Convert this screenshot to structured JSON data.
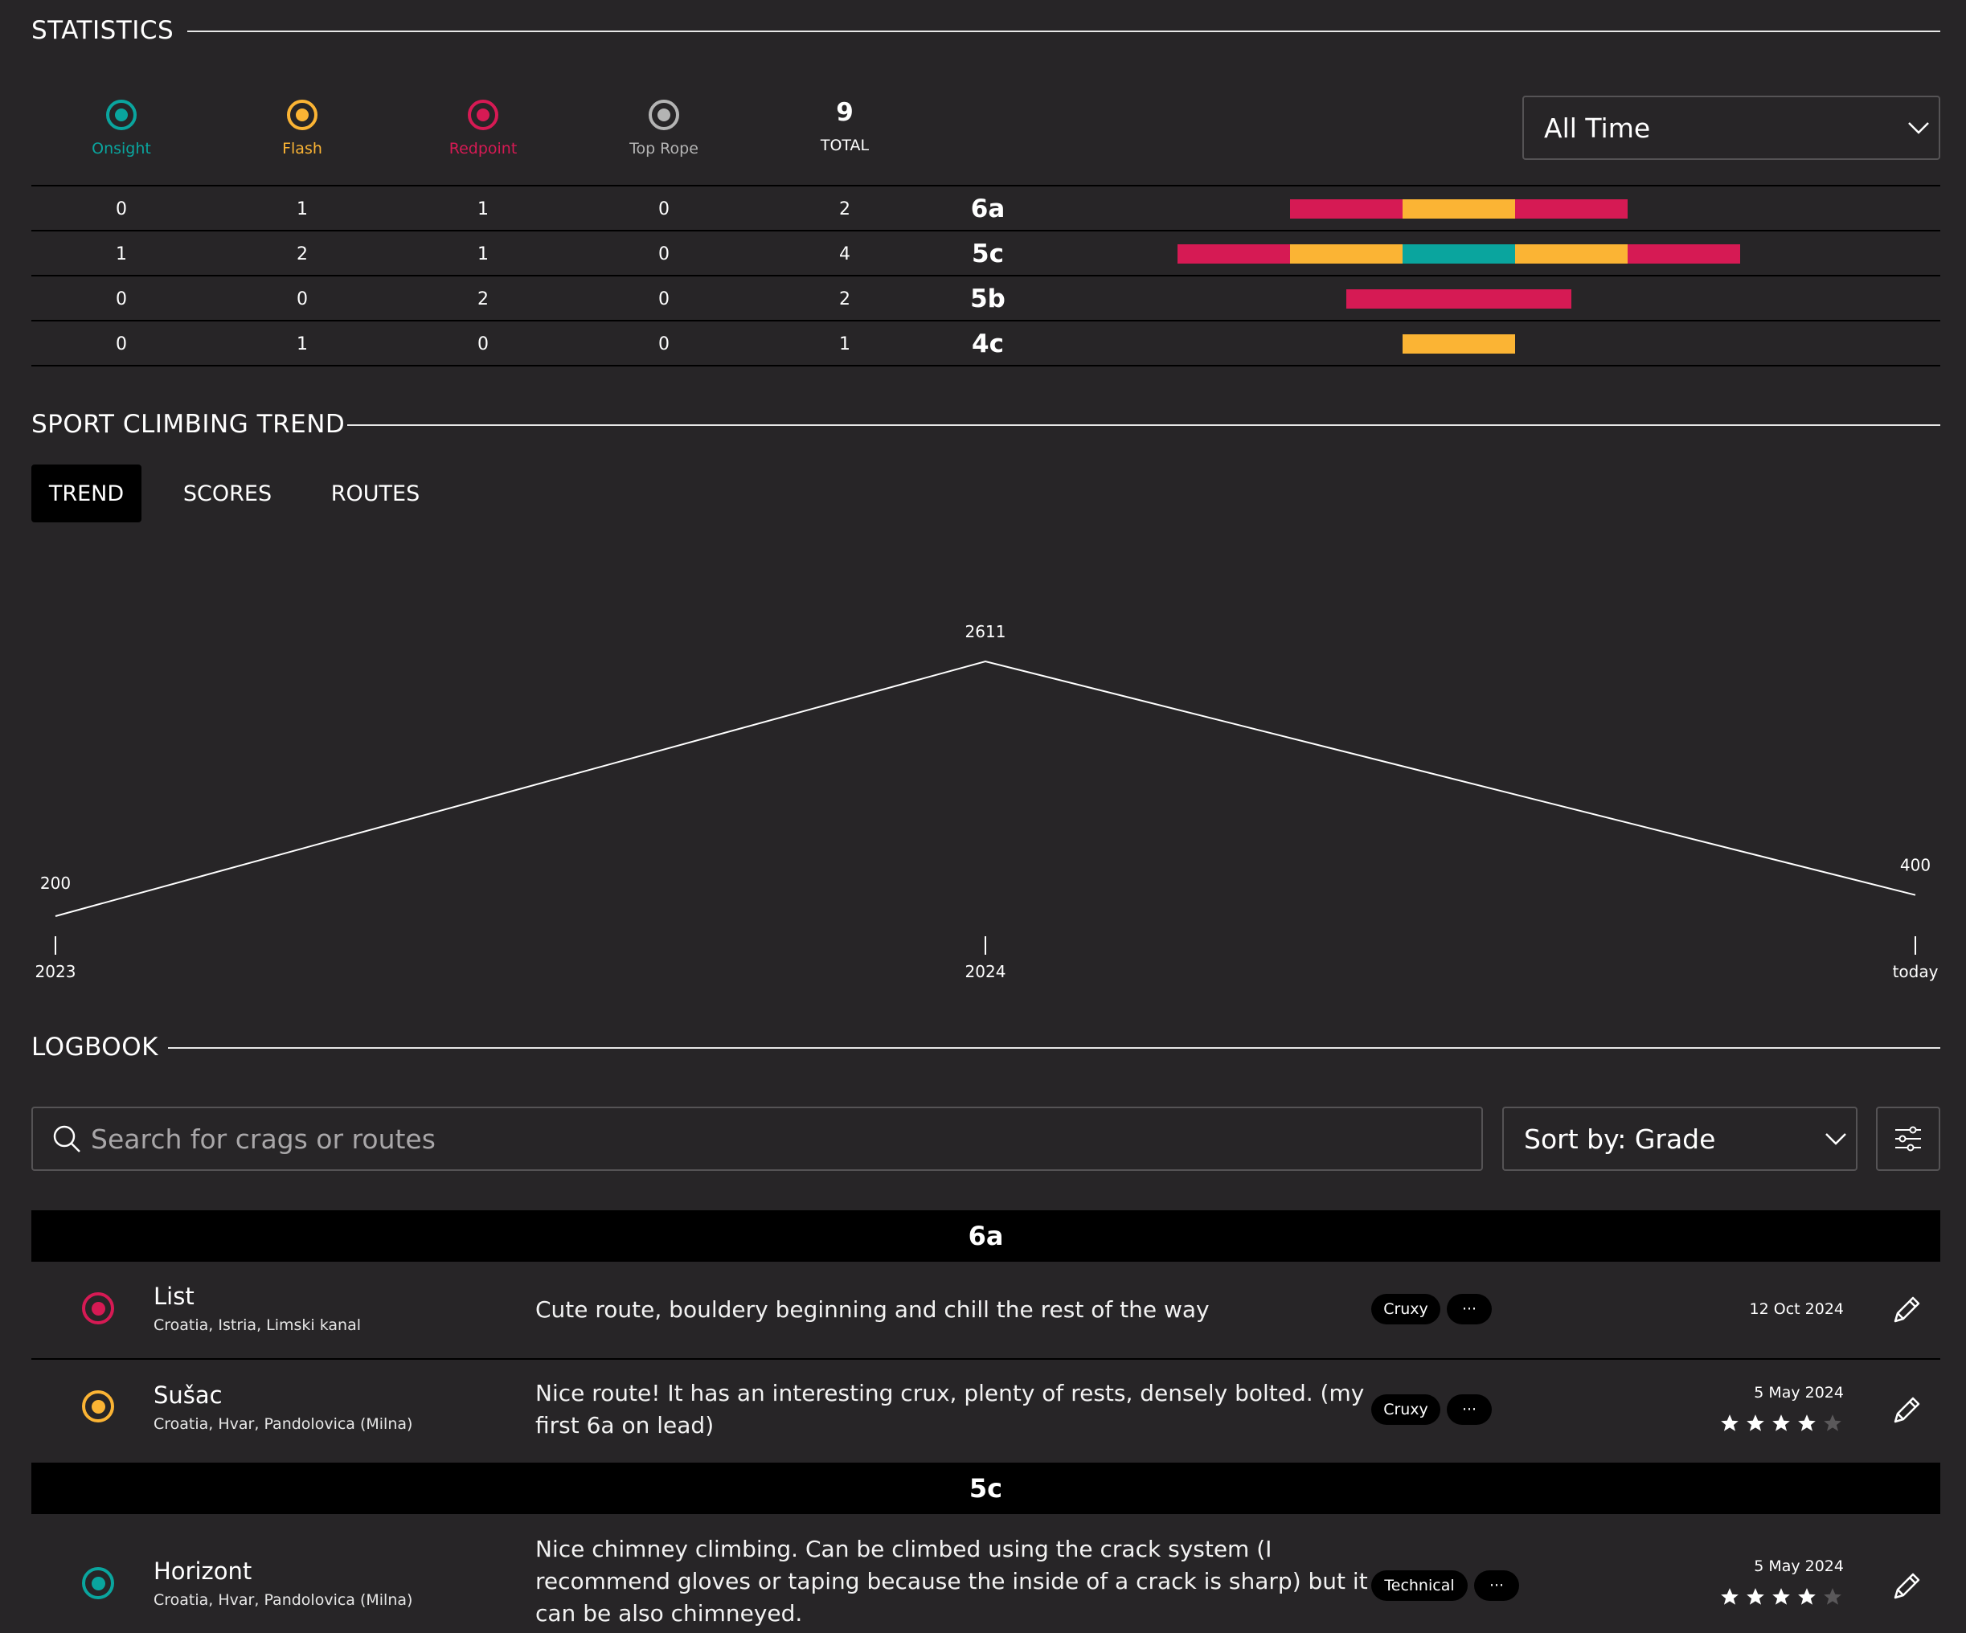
{
  "statistics": {
    "title": "STATISTICS",
    "legend": [
      {
        "label": "Onsight",
        "color": "#0aa59e",
        "icon": "onsight-icon"
      },
      {
        "label": "Flash",
        "color": "#fbb434",
        "icon": "flash-icon"
      },
      {
        "label": "Redpoint",
        "color": "#d61a54",
        "icon": "redpoint-icon"
      },
      {
        "label": "Top Rope",
        "color": "#b4b4b4",
        "icon": "top-rope-icon"
      }
    ],
    "total": {
      "value": "9",
      "label": "TOTAL"
    },
    "period": {
      "selected": "All Time"
    },
    "rows": [
      {
        "onsight": "0",
        "flash": "1",
        "redpoint": "1",
        "toprope": "0",
        "total": "2",
        "grade": "6a",
        "segments": [
          "redpoint",
          "flash",
          "redpoint"
        ]
      },
      {
        "onsight": "1",
        "flash": "2",
        "redpoint": "1",
        "toprope": "0",
        "total": "4",
        "grade": "5c",
        "segments": [
          "redpoint",
          "flash",
          "onsight",
          "flash",
          "redpoint"
        ]
      },
      {
        "onsight": "0",
        "flash": "0",
        "redpoint": "2",
        "toprope": "0",
        "total": "2",
        "grade": "5b",
        "segments": [
          "redpoint",
          "redpoint"
        ]
      },
      {
        "onsight": "0",
        "flash": "1",
        "redpoint": "0",
        "toprope": "0",
        "total": "1",
        "grade": "4c",
        "segments": [
          "flash"
        ]
      }
    ]
  },
  "trend": {
    "title": "SPORT CLIMBING TREND",
    "tabs": [
      {
        "label": "TREND",
        "active": true
      },
      {
        "label": "SCORES",
        "active": false
      },
      {
        "label": "ROUTES",
        "active": false
      }
    ]
  },
  "chart_data": {
    "type": "line",
    "x": [
      "2023",
      "2024",
      "today"
    ],
    "values": [
      200,
      2611,
      400
    ],
    "data_labels": [
      "200",
      "2611",
      "400"
    ],
    "title": "",
    "xlabel": "",
    "ylabel": "",
    "grid": false
  },
  "logbook": {
    "title": "LOGBOOK",
    "search": {
      "placeholder": "Search for crags or routes"
    },
    "sort": {
      "selected": "Sort by: Grade"
    },
    "groups": [
      {
        "grade": "6a",
        "entries": [
          {
            "style": "redpoint",
            "name": "List",
            "location": "Croatia, Istria, Limski kanal",
            "comment": "Cute route, bouldery beginning and chill the rest of the way",
            "tag": "Cruxy",
            "more": "···",
            "date": "12 Oct 2024",
            "rating": null
          },
          {
            "style": "flash",
            "name": "Sušac",
            "location": "Croatia, Hvar, Pandolovica (Milna)",
            "comment": "Nice route! It has an interesting crux, plenty of rests, densely bolted. (my first 6a on lead)",
            "tag": "Cruxy",
            "more": "···",
            "date": "5 May 2024",
            "rating": 4
          }
        ]
      },
      {
        "grade": "5c",
        "entries": [
          {
            "style": "onsight",
            "name": "Horizont",
            "location": "Croatia, Hvar, Pandolovica (Milna)",
            "comment": "Nice chimney climbing. Can be climbed using the crack system (I recommend gloves or taping because the inside of a crack is sharp) but it can be also chimneyed.",
            "tag": "Technical",
            "more": "···",
            "date": "5 May 2024",
            "rating": 4
          }
        ]
      }
    ],
    "rating_max": 5
  },
  "colors": {
    "onsight": "#0aa59e",
    "flash": "#fbb434",
    "redpoint": "#d61a54",
    "toprope": "#b4b4b4",
    "background": "#272527"
  }
}
